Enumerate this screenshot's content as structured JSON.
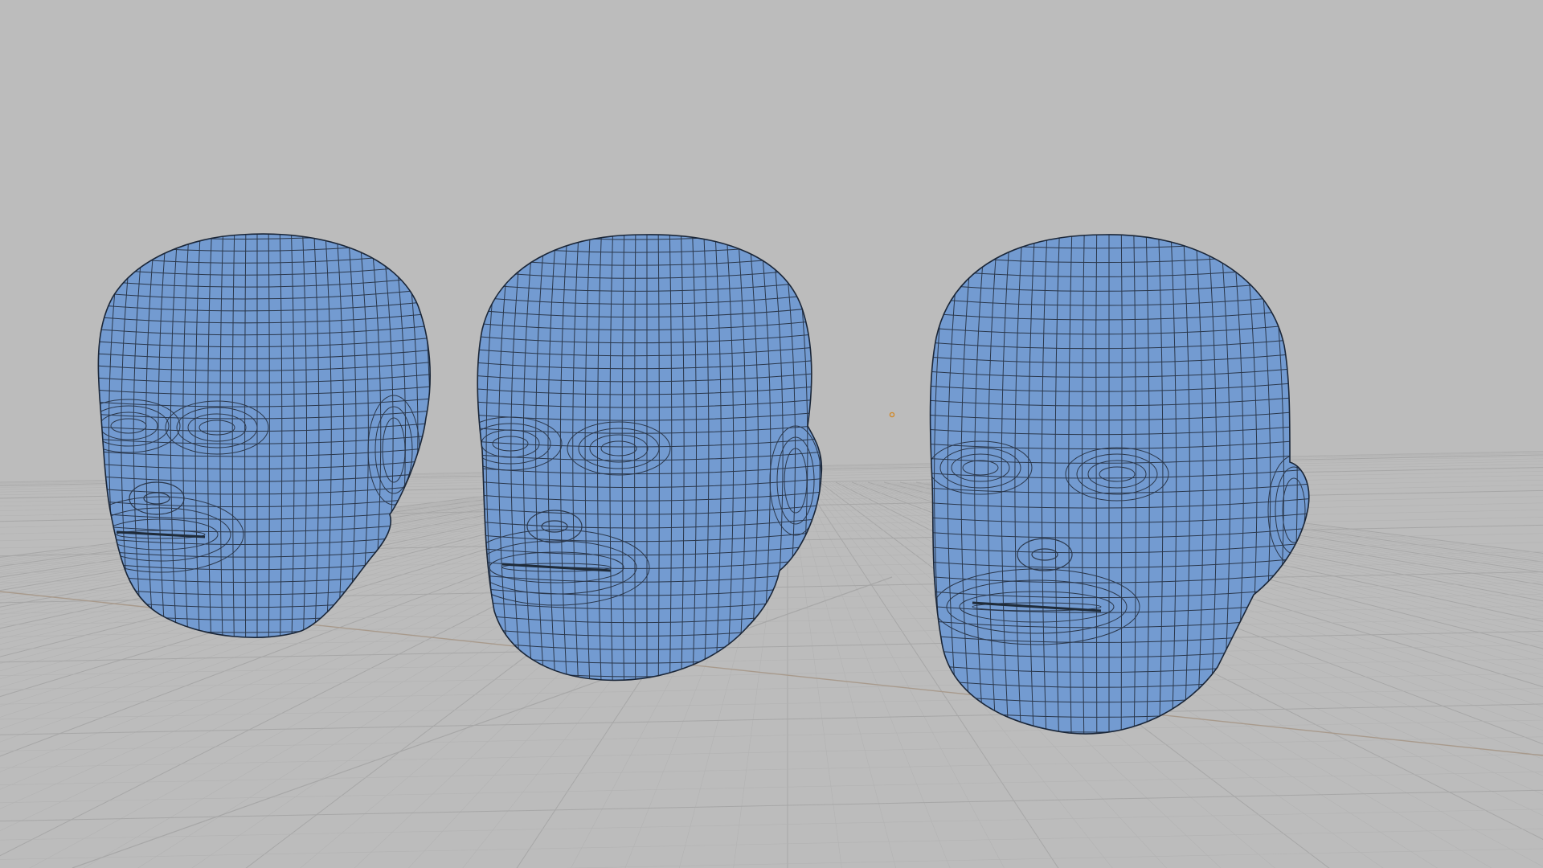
{
  "viewport": {
    "background_color": "#bcbcbc",
    "grid_minor_color": "#b3b3b3",
    "grid_major_color": "#a7a7a7",
    "axis_line_color": "#a89a8c"
  },
  "scene": {
    "origin_marker": {
      "icon": "origin-point-icon",
      "color": "#d08a2c"
    },
    "objects": [
      {
        "id": "head-mesh-left",
        "color": "#6c96cf",
        "wire_color": "#1c2a3e",
        "view": "three-quarter-left"
      },
      {
        "id": "head-mesh-middle",
        "color": "#6c96cf",
        "wire_color": "#1c2a3e",
        "view": "three-quarter-front"
      },
      {
        "id": "head-mesh-right",
        "color": "#6c96cf",
        "wire_color": "#1c2a3e",
        "view": "front"
      }
    ]
  }
}
